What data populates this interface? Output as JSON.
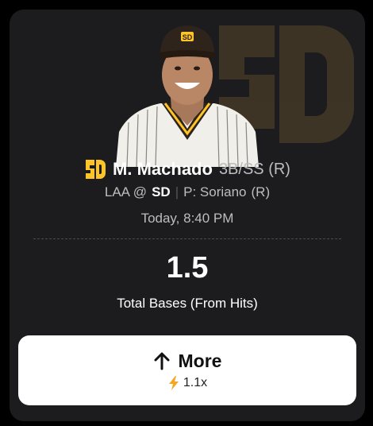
{
  "player": {
    "name": "M. Machado",
    "position": "3B/SS (R)",
    "team_logo": "SD"
  },
  "matchup": {
    "away": "LAA @",
    "home": "SD",
    "separator": "|",
    "pitcher": "P: Soriano",
    "pitcher_hand": "(R)"
  },
  "game_time": "Today, 8:40 PM",
  "projection": {
    "value": "1.5",
    "stat": "Total Bases (From Hits)"
  },
  "action": {
    "label": "More",
    "multiplier": "1.1x"
  },
  "icons": {
    "direction": "arrow-up-icon",
    "boost": "lightning-bolt-icon"
  },
  "colors": {
    "card_bg": "#1c1c1e",
    "team_gold": "#ffc425",
    "team_brown": "#3a2a1a",
    "boost_orange": "#f5a623"
  }
}
